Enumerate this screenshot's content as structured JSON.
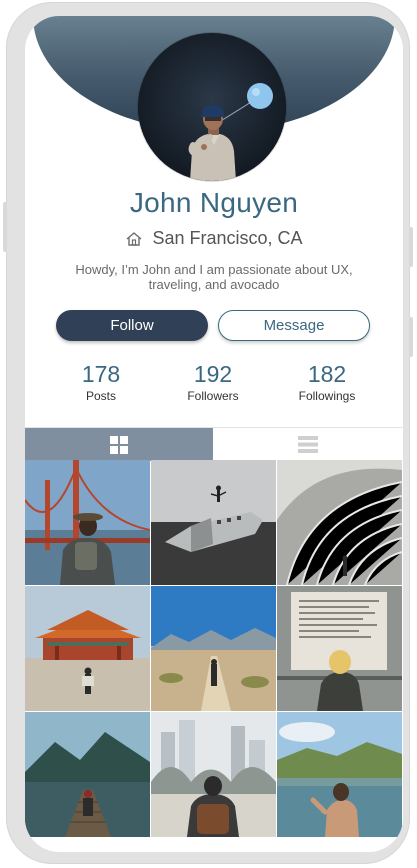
{
  "profile": {
    "name": "John Nguyen",
    "location": "San Francisco, CA",
    "bio": "Howdy, I’m John and I am passionate about UX, traveling, and avocado"
  },
  "actions": {
    "follow_label": "Follow",
    "message_label": "Message"
  },
  "stats": [
    {
      "value": "178",
      "label": "Posts"
    },
    {
      "value": "192",
      "label": "Followers"
    },
    {
      "value": "182",
      "label": "Followings"
    }
  ],
  "tabs": {
    "active": "grid",
    "items": [
      {
        "icon": "grid-view-icon"
      },
      {
        "icon": "list-view-icon"
      }
    ]
  },
  "gallery": [
    {
      "subject": "golden-gate-bridge-backpacker"
    },
    {
      "subject": "plane-wreck-on-black-sand"
    },
    {
      "subject": "curved-concrete-building"
    },
    {
      "subject": "asian-temple-plaza"
    },
    {
      "subject": "desert-trail-walker"
    },
    {
      "subject": "poster-wall-viewer"
    },
    {
      "subject": "mountain-dock"
    },
    {
      "subject": "city-skyline-backpacker"
    },
    {
      "subject": "mountain-lake-swimmer"
    }
  ],
  "colors": {
    "accent": "#3a6880",
    "primary_button": "#2f4057",
    "header_gradient_top": "#68808f",
    "header_gradient_bottom": "#2f4356",
    "active_tab": "#7f8fa0"
  }
}
